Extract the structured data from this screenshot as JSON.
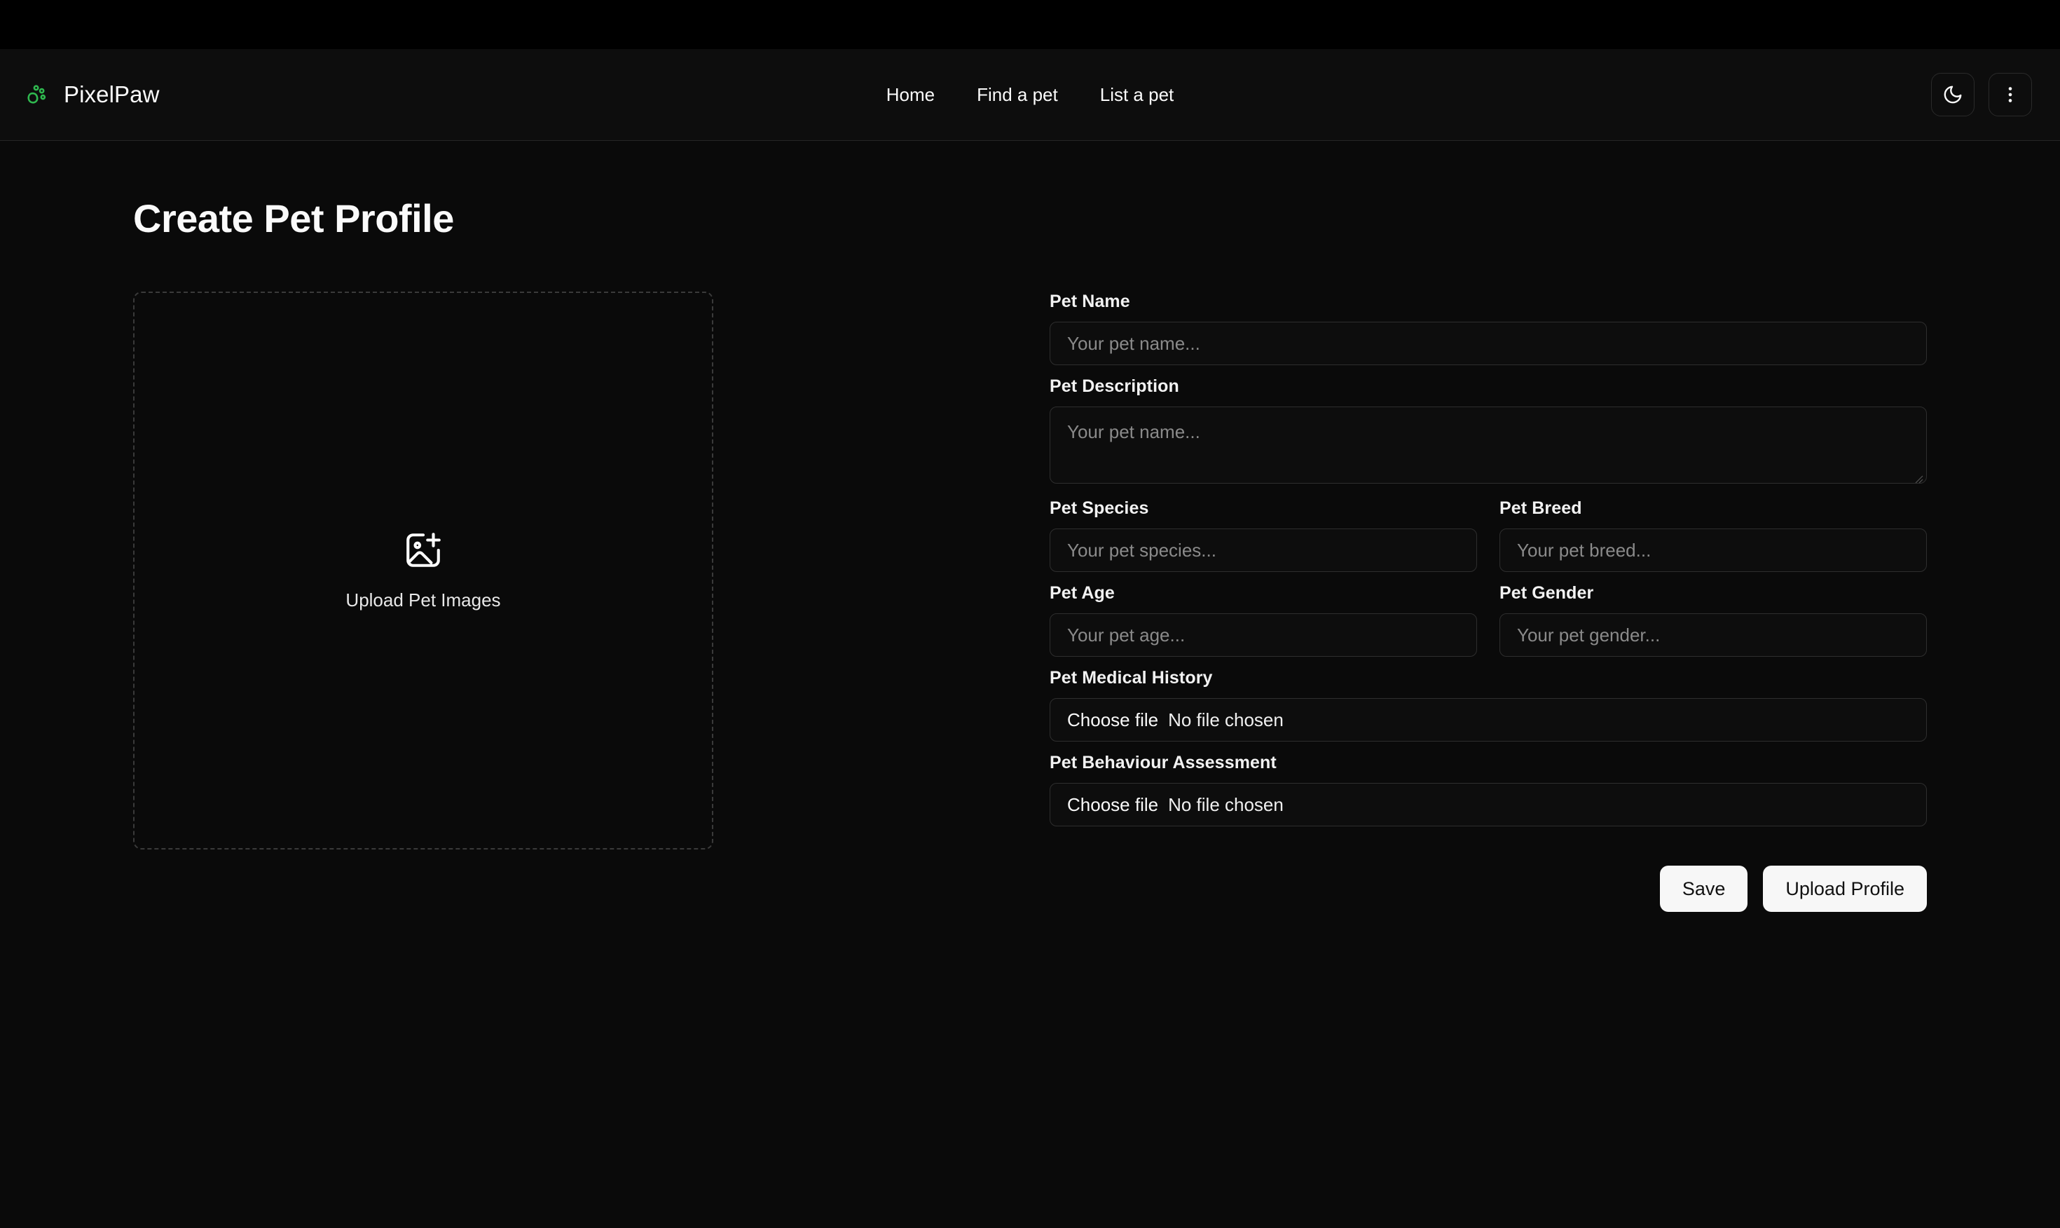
{
  "brand": {
    "name": "PixelPaw",
    "logo_icon": "paw-icon",
    "logo_color": "#2fb84f"
  },
  "nav": {
    "items": [
      {
        "label": "Home"
      },
      {
        "label": "Find a pet"
      },
      {
        "label": "List a pet"
      }
    ]
  },
  "header_actions": {
    "theme_toggle_icon": "moon-icon",
    "overflow_menu_icon": "kebab-menu-icon"
  },
  "page": {
    "title": "Create Pet Profile"
  },
  "upload": {
    "icon": "image-plus-icon",
    "label": "Upload Pet Images"
  },
  "form": {
    "pet_name": {
      "label": "Pet Name",
      "placeholder": "Your pet name...",
      "value": ""
    },
    "pet_description": {
      "label": "Pet Description",
      "placeholder": "Your pet name...",
      "value": ""
    },
    "pet_species": {
      "label": "Pet Species",
      "placeholder": "Your pet species...",
      "value": ""
    },
    "pet_breed": {
      "label": "Pet Breed",
      "placeholder": "Your pet breed...",
      "value": ""
    },
    "pet_age": {
      "label": "Pet Age",
      "placeholder": "Your pet age...",
      "value": ""
    },
    "pet_gender": {
      "label": "Pet Gender",
      "placeholder": "Your pet gender...",
      "value": ""
    },
    "pet_medical_history": {
      "label": "Pet Medical History",
      "choose_file_label": "Choose file",
      "file_status": "No file chosen"
    },
    "pet_behaviour_assessment": {
      "label": "Pet Behaviour Assessment",
      "choose_file_label": "Choose file",
      "file_status": "No file chosen"
    }
  },
  "actions": {
    "save_label": "Save",
    "upload_profile_label": "Upload Profile"
  },
  "theme": {
    "background": "#0a0a0a",
    "header_background": "#0d0d0d",
    "border": "#262626",
    "text": "#fafafa",
    "muted_text": "#8a8a8a",
    "accent": "#2fb84f",
    "button_background": "#f7f7f7",
    "button_text": "#111111"
  }
}
